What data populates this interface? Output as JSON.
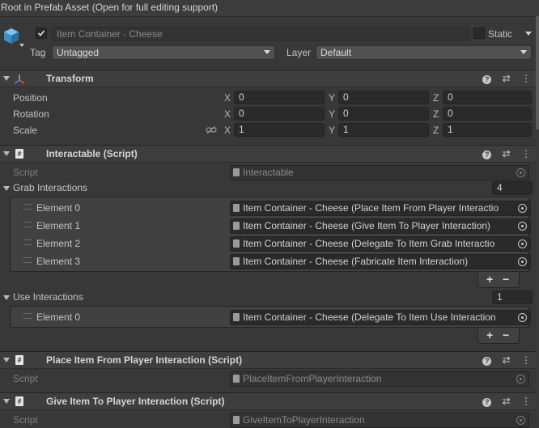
{
  "banner": {
    "text": "Root in Prefab Asset (Open for full editing support)"
  },
  "gameobject": {
    "name": "Item Container - Cheese",
    "active": true,
    "static_label": "Static",
    "tag_label": "Tag",
    "tag_value": "Untagged",
    "layer_label": "Layer",
    "layer_value": "Default"
  },
  "transform": {
    "title": "Transform",
    "rows": [
      {
        "label": "Position",
        "x": "0",
        "y": "0",
        "z": "0"
      },
      {
        "label": "Rotation",
        "x": "0",
        "y": "0",
        "z": "0"
      },
      {
        "label": "Scale",
        "x": "1",
        "y": "1",
        "z": "1"
      }
    ],
    "axis": {
      "x": "X",
      "y": "Y",
      "z": "Z"
    }
  },
  "interactable": {
    "title": "Interactable (Script)",
    "script_label": "Script",
    "script_value": "Interactable",
    "grab": {
      "label": "Grab Interactions",
      "count": "4",
      "elements": [
        {
          "label": "Element 0",
          "value": "Item Container - Cheese (Place Item From Player Interactio"
        },
        {
          "label": "Element 1",
          "value": "Item Container - Cheese (Give Item To Player Interaction)"
        },
        {
          "label": "Element 2",
          "value": "Item Container - Cheese (Delegate To Item Grab Interactio"
        },
        {
          "label": "Element 3",
          "value": "Item Container - Cheese (Fabricate Item Interaction)"
        }
      ]
    },
    "use": {
      "label": "Use Interactions",
      "count": "1",
      "elements": [
        {
          "label": "Element 0",
          "value": "Item Container - Cheese (Delegate To Item Use Interaction"
        }
      ]
    },
    "plus": "+",
    "minus": "−"
  },
  "place_item": {
    "title": "Place Item From Player Interaction (Script)",
    "script_label": "Script",
    "script_value": "PlaceItemFromPlayerInteraction"
  },
  "give_item": {
    "title": "Give Item To Player Interaction (Script)",
    "script_label": "Script",
    "script_value": "GiveItemToPlayerInteraction"
  },
  "icons": {
    "help": "?",
    "presets": "⇄",
    "more": "⋮",
    "script_hash": "#"
  },
  "colors": {
    "background": "#383838",
    "header": "#3e3e3e",
    "field": "#2a2a2a",
    "text": "#c4c4c4"
  }
}
